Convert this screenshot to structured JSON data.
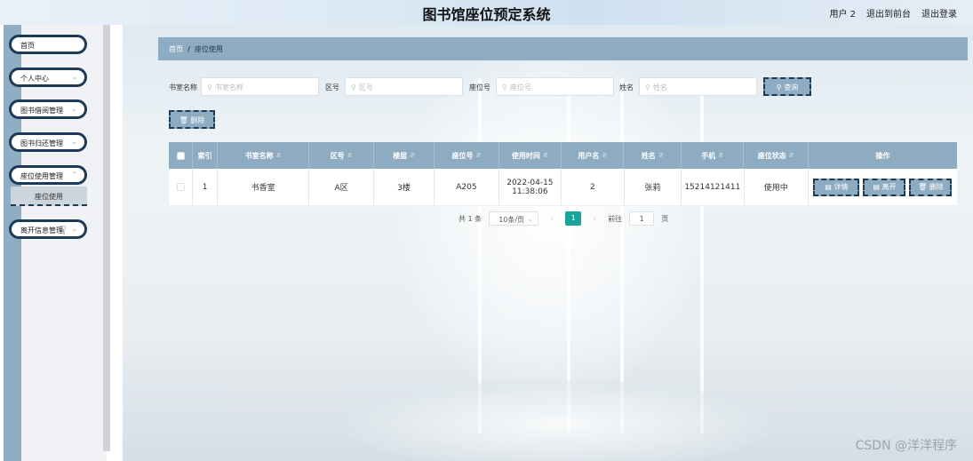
{
  "header": {
    "title": "图书馆座位预定系统",
    "links": [
      "用户 2",
      "退出到前台",
      "退出登录"
    ]
  },
  "sidebar": {
    "items": [
      {
        "label": "首页"
      },
      {
        "label": "个人中心"
      },
      {
        "label": "图书借阅管理"
      },
      {
        "label": "图书归还管理"
      },
      {
        "label": "座位使用管理"
      },
      {
        "label": "离开信息管理"
      }
    ],
    "submenu": {
      "label": "座位使用"
    }
  },
  "breadcrumb": {
    "home": "首页",
    "sep": "/",
    "current": "座位使用"
  },
  "search": {
    "room_label": "书室名称",
    "room_placeholder": "书室名称",
    "zone_label": "区号",
    "zone_placeholder": "区号",
    "seat_label": "座位号",
    "seat_placeholder": "座位号",
    "name_label": "姓名",
    "name_placeholder": "姓名",
    "query_button": "查询",
    "delete_button": "删除"
  },
  "table": {
    "headers": [
      "索引",
      "书室名称",
      "区号",
      "楼层",
      "座位号",
      "使用时间",
      "用户名",
      "姓名",
      "手机",
      "座位状态",
      "操作"
    ],
    "rows": [
      [
        "1",
        "书香室",
        "A区",
        "3楼",
        "A205",
        "2022-04-15 11:38:06",
        "2",
        "张莉",
        "15214121411",
        "使用中"
      ]
    ],
    "row_actions": [
      "详情",
      "离开",
      "删除"
    ]
  },
  "pagination": {
    "total": "共 1 条",
    "page_size": "10条/页",
    "current_page": "1",
    "goto_label": "前往",
    "goto_value": "1",
    "page_suffix": "页"
  },
  "watermark": "CSDN @洋洋程序"
}
